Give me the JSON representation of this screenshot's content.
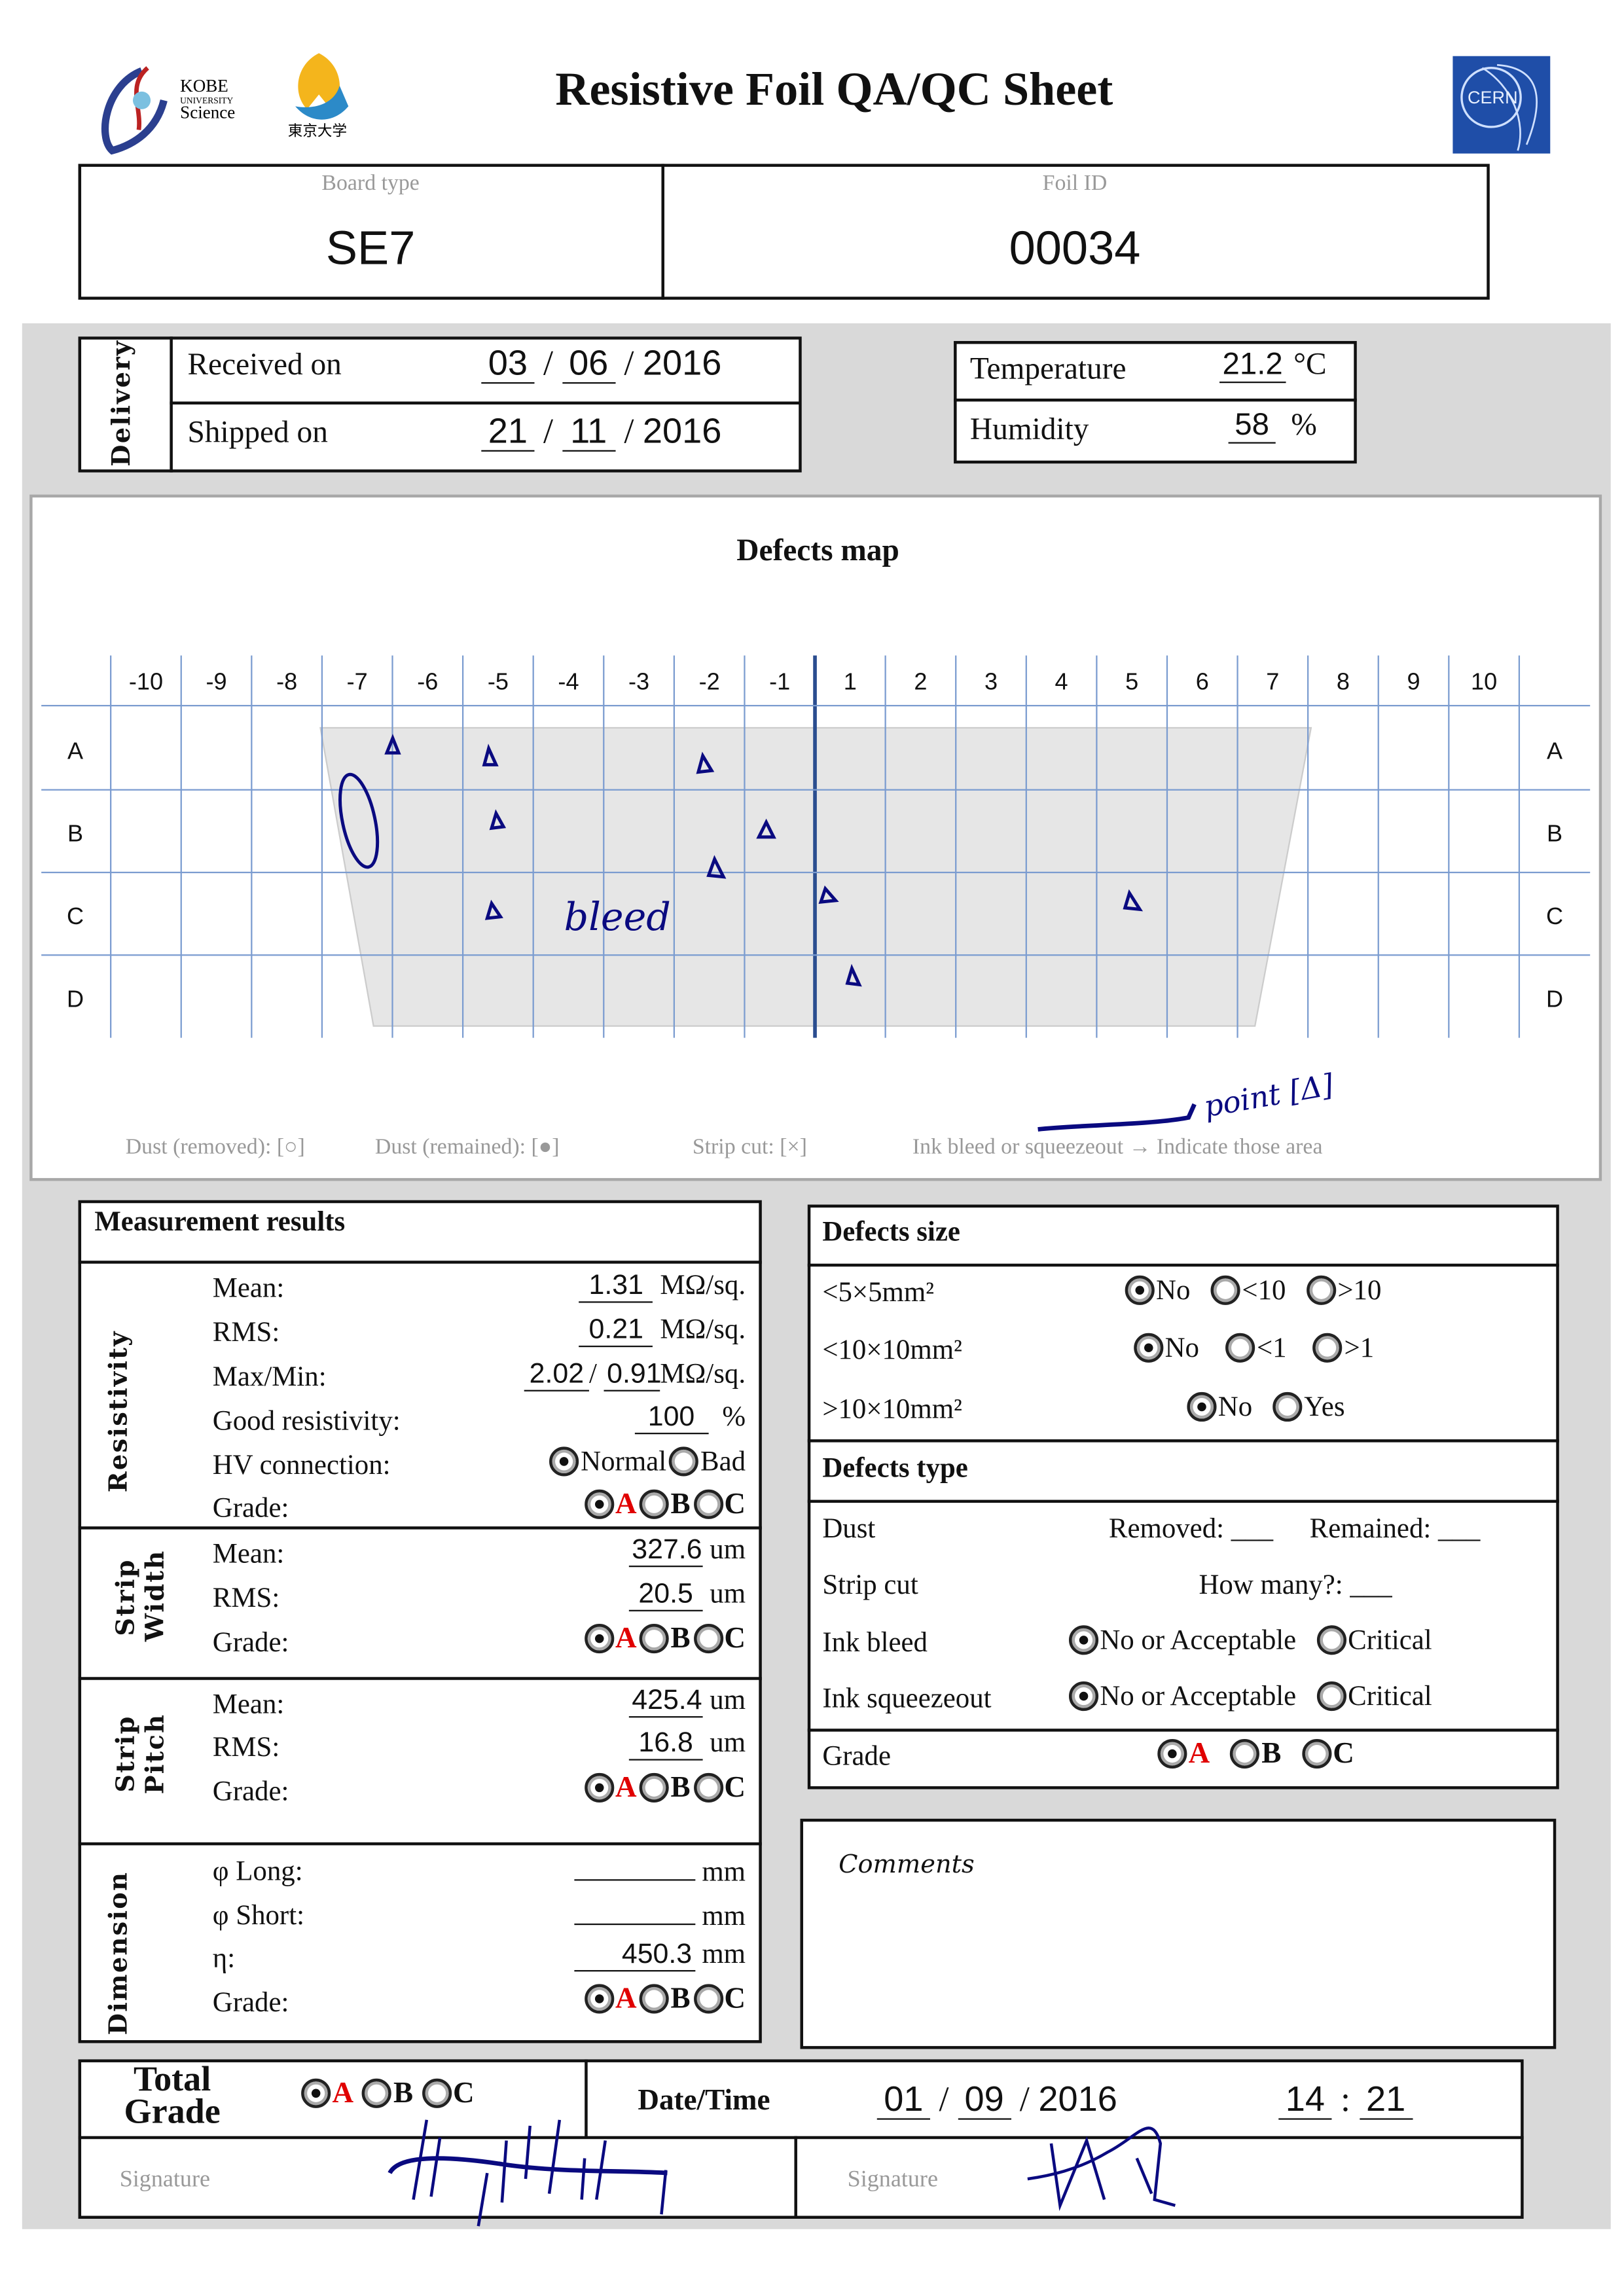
{
  "header": {
    "title": "Resistive Foil QA/QC Sheet",
    "logos": {
      "kobe": "KOBE UNIVERSITY Science",
      "tokyo": "東京大学",
      "cern": "CERN"
    },
    "board_type_label": "Board type",
    "board_type": "SE7",
    "foil_id_label": "Foil ID",
    "foil_id": "00034"
  },
  "delivery": {
    "section_label": "Delivery",
    "received_label": "Received on",
    "received": {
      "day": "03",
      "month": "06",
      "year": "2016"
    },
    "shipped_label": "Shipped on",
    "shipped": {
      "day": "21",
      "month": "11",
      "year": "2016"
    },
    "sep": "/"
  },
  "environment": {
    "temperature_label": "Temperature",
    "temperature": "21.2",
    "temperature_unit": "°C",
    "humidity_label": "Humidity",
    "humidity": "58",
    "humidity_unit": "%"
  },
  "defects_map": {
    "title": "Defects map",
    "columns": [
      "-10",
      "-9",
      "-8",
      "-7",
      "-6",
      "-5",
      "-4",
      "-3",
      "-2",
      "-1",
      "1",
      "2",
      "3",
      "4",
      "5",
      "6",
      "7",
      "8",
      "9",
      "10"
    ],
    "rows": [
      "A",
      "B",
      "C",
      "D"
    ],
    "legend": {
      "dust_removed": "Dust (removed): [○]",
      "dust_remained": "Dust (remained): [●]",
      "strip_cut": "Strip cut: [×]",
      "ink": "Ink bleed or squeezeout → Indicate those area"
    },
    "annotations": {
      "bleed": "bleed",
      "point": "point [Δ]"
    },
    "ink_color": "#0a0a80"
  },
  "measurement": {
    "title": "Measurement results",
    "resistivity": {
      "label": "Resistivity",
      "mean_label": "Mean:",
      "mean": "1.31",
      "unit": "MΩ/sq.",
      "rms_label": "RMS:",
      "rms": "0.21",
      "maxmin_label": "Max/Min:",
      "max": "2.02",
      "min": "0.91",
      "good_label": "Good resistivity:",
      "good": "100",
      "good_unit": "%",
      "hv_label": "HV connection:",
      "hv_options": [
        "Normal",
        "Bad"
      ],
      "hv_selected": "Normal",
      "grade_label": "Grade:",
      "grade_selected": "A"
    },
    "strip_width": {
      "label": "Strip Width",
      "mean_label": "Mean:",
      "mean": "327.6",
      "unit": "um",
      "rms_label": "RMS:",
      "rms": "20.5",
      "grade_label": "Grade:",
      "grade_selected": "A"
    },
    "strip_pitch": {
      "label": "Strip Pitch",
      "mean_label": "Mean:",
      "mean": "425.4",
      "unit": "um",
      "rms_label": "RMS:",
      "rms": "16.8",
      "grade_label": "Grade:",
      "grade_selected": "A"
    },
    "dimension": {
      "label": "Dimension",
      "long_label": "φ Long:",
      "long": "",
      "short_label": "φ Short:",
      "short": "",
      "eta_label": "η:",
      "eta": "450.3",
      "unit": "mm",
      "grade_label": "Grade:",
      "grade_selected": "A"
    },
    "grades": [
      "A",
      "B",
      "C"
    ]
  },
  "defects": {
    "size_title": "Defects size",
    "size_rows": [
      {
        "label": "<5×5mm²",
        "options": [
          "No",
          "<10",
          ">10"
        ],
        "selected": "No"
      },
      {
        "label": "<10×10mm²",
        "options": [
          "No",
          "<1",
          ">1"
        ],
        "selected": "No"
      },
      {
        "label": ">10×10mm²",
        "options": [
          "No",
          "Yes"
        ],
        "selected": "No"
      }
    ],
    "type_title": "Defects type",
    "dust_label": "Dust",
    "removed_label": "Removed: ___",
    "remained_label": "Remained: ___",
    "strip_cut_label": "Strip cut",
    "how_many_label": "How many?: ___",
    "ink_bleed_label": "Ink bleed",
    "ink_squeeze_label": "Ink squeezeout",
    "ink_options": [
      "No or Acceptable",
      "Critical"
    ],
    "ink_bleed_selected": "No or Acceptable",
    "ink_squeeze_selected": "No or Acceptable",
    "grade_label": "Grade",
    "grade_selected": "A"
  },
  "comments": {
    "label": "Comments"
  },
  "total": {
    "label_line1": "Total",
    "label_line2": "Grade",
    "grade_selected": "A",
    "datetime_label": "Date/Time",
    "date": {
      "day": "01",
      "month": "09",
      "year": "2016"
    },
    "time": {
      "hour": "14",
      "minute": "21"
    },
    "signature_label": "Signature"
  },
  "colors": {
    "background_band": "#d9d9d9",
    "selected_grade": "#e00000",
    "cern_blue": "#1f4ea8",
    "map_board": "#e6e6e6"
  }
}
